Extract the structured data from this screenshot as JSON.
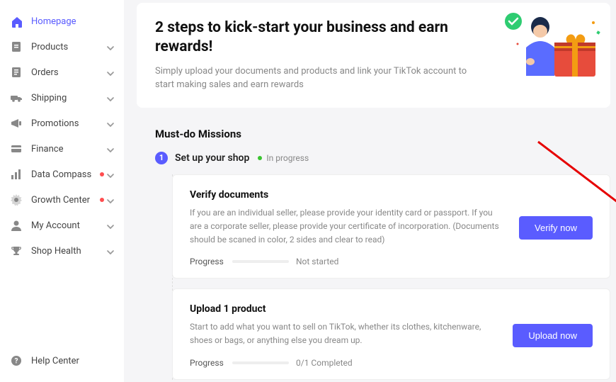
{
  "sidebar": {
    "items": [
      {
        "label": "Homepage",
        "icon": "home",
        "active": true,
        "expandable": false,
        "badge": false
      },
      {
        "label": "Products",
        "icon": "file",
        "active": false,
        "expandable": true,
        "badge": false
      },
      {
        "label": "Orders",
        "icon": "doc",
        "active": false,
        "expandable": true,
        "badge": false
      },
      {
        "label": "Shipping",
        "icon": "truck",
        "active": false,
        "expandable": true,
        "badge": false
      },
      {
        "label": "Promotions",
        "icon": "megaphone",
        "active": false,
        "expandable": true,
        "badge": false
      },
      {
        "label": "Finance",
        "icon": "card",
        "active": false,
        "expandable": true,
        "badge": false
      },
      {
        "label": "Data Compass",
        "icon": "chart",
        "active": false,
        "expandable": true,
        "badge": true
      },
      {
        "label": "Growth Center",
        "icon": "gear",
        "active": false,
        "expandable": true,
        "badge": true
      },
      {
        "label": "My Account",
        "icon": "user",
        "active": false,
        "expandable": true,
        "badge": false
      },
      {
        "label": "Shop Health",
        "icon": "trophy",
        "active": false,
        "expandable": true,
        "badge": false
      }
    ],
    "footer": {
      "label": "Help Center",
      "icon": "help"
    }
  },
  "hero": {
    "title": "2 steps to kick-start your business and earn rewards!",
    "subtitle": "Simply upload your documents and products and link your TikTok account to start making sales and earn rewards"
  },
  "missions": {
    "section_title": "Must-do Missions",
    "step_num": "1",
    "step_title": "Set up your shop",
    "step_status": "In progress",
    "cards": [
      {
        "title": "Verify documents",
        "desc": "If you are an individual seller, please provide your identity card or passport. If you are a corporate seller, please provide your certificate of incorporation. (Documents should be scaned in color, 2 sides and clear to read)",
        "progress_label": "Progress",
        "progress_text": "Not started",
        "button": "Verify now"
      },
      {
        "title": "Upload 1 product",
        "desc": "Start to add what you want to sell on TikTok, whether its clothes, kitchenware, shoes or bags, or anything else you dream up.",
        "progress_label": "Progress",
        "progress_text": "0/1 Completed",
        "button": "Upload now"
      }
    ]
  },
  "annotation": {
    "highlight_color": "#e60000",
    "arrow_color": "#e60000"
  }
}
